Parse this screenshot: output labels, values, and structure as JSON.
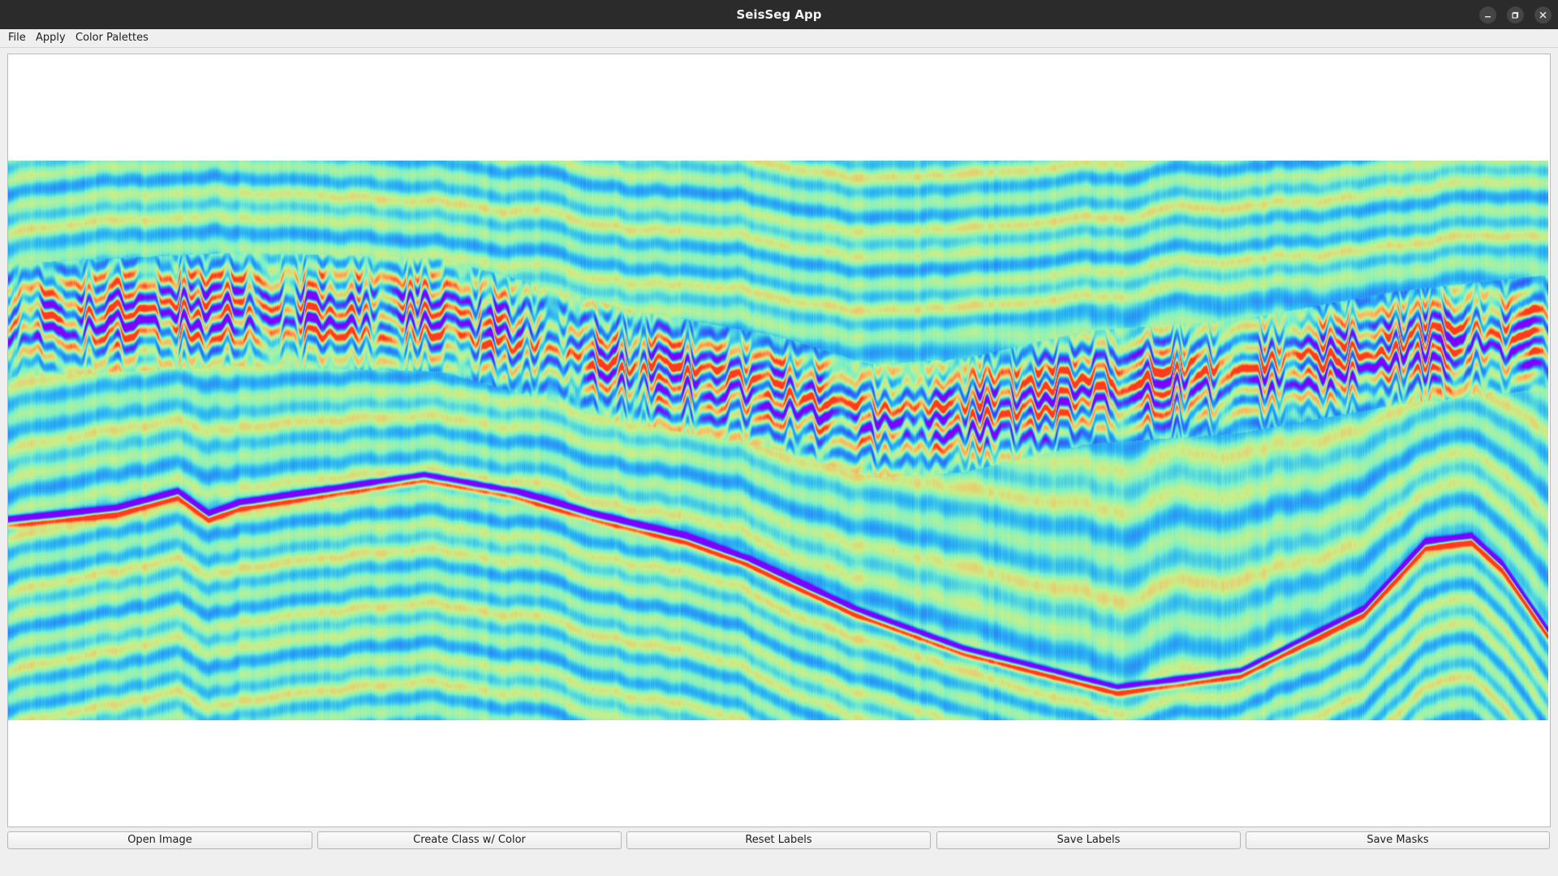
{
  "window": {
    "title": "SeisSeg App",
    "controls": {
      "minimize_icon": "minimize-icon",
      "maximize_icon": "maximize-icon",
      "close_icon": "close-icon"
    }
  },
  "menubar": {
    "items": [
      {
        "label": "File"
      },
      {
        "label": "Apply"
      },
      {
        "label": "Color Palettes"
      }
    ]
  },
  "canvas": {
    "image": "seismic-section",
    "colormap": [
      "#7f00ff",
      "#2f6cf6",
      "#2bb7f3",
      "#7bf0c9",
      "#c8f08a",
      "#ffb45f",
      "#ff3b1e"
    ]
  },
  "buttons": {
    "open_image": "Open Image",
    "create_class": "Create Class w/ Color",
    "reset_labels": "Reset Labels",
    "save_labels": "Save Labels",
    "save_masks": "Save Masks"
  }
}
